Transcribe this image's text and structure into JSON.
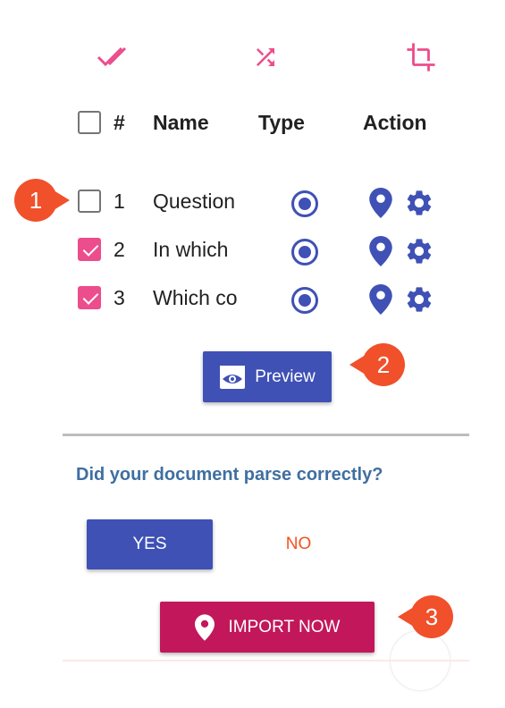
{
  "toolbar": {
    "icons": [
      "double-check-icon",
      "shuffle-icon",
      "crop-icon"
    ],
    "icon_color": "#ec4d8c"
  },
  "table": {
    "headers": {
      "hash": "#",
      "name": "Name",
      "type": "Type",
      "action": "Action"
    },
    "rows": [
      {
        "num": "1",
        "name": "Question",
        "checked": false
      },
      {
        "num": "2",
        "name": "In which",
        "checked": true
      },
      {
        "num": "3",
        "name": "Which co",
        "checked": true
      }
    ]
  },
  "preview_button": {
    "label": "Preview"
  },
  "parse_question": "Did your document parse correctly?",
  "yes_button": {
    "label": "YES"
  },
  "no_button": {
    "label": "NO"
  },
  "import_button": {
    "label": "IMPORT NOW"
  },
  "callouts": [
    "1",
    "2",
    "3"
  ],
  "colors": {
    "primary": "#3f51b5",
    "accent_pink": "#ec4d8c",
    "import_button": "#c2185b",
    "callout": "#f0502a",
    "question_text": "#3f6fa0",
    "no_text": "#f4511e"
  }
}
